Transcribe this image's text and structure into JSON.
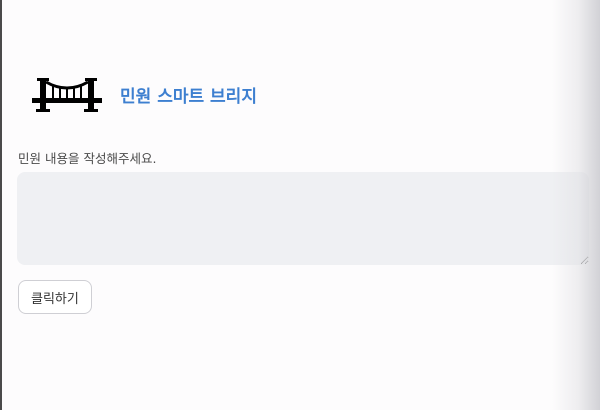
{
  "header": {
    "logo_icon": "bridge-icon",
    "title": "민원 스마트 브리지"
  },
  "form": {
    "prompt_label": "민원 내용을 작성해주세요.",
    "textarea_value": "",
    "submit_label": "클릭하기"
  },
  "colors": {
    "title": "#3d7fd0",
    "textarea_bg": "#eff0f3",
    "page_bg": "#fdfcfd"
  }
}
